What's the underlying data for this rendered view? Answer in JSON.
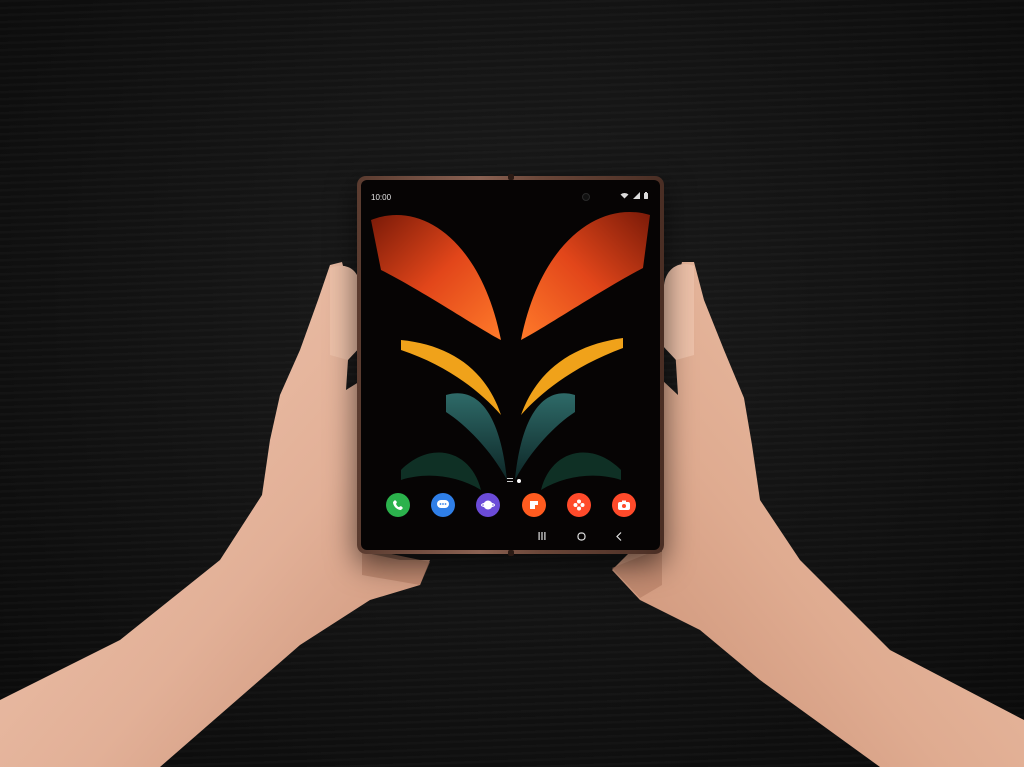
{
  "status_bar": {
    "time": "10:00",
    "icons": [
      "wifi-icon",
      "signal-icon",
      "battery-icon"
    ]
  },
  "home_screen": {
    "page_indicator": [
      "apps-grid-indicator",
      "current-page-dot"
    ],
    "dock": [
      {
        "name": "phone-app-icon",
        "color": "#2bb24c"
      },
      {
        "name": "messages-app-icon",
        "color": "#2f7fe8"
      },
      {
        "name": "internet-app-icon",
        "color": "#6b4bd8"
      },
      {
        "name": "store-app-icon",
        "color": "#ff5b1f"
      },
      {
        "name": "gallery-app-icon",
        "color": "#ff4a2a"
      },
      {
        "name": "camera-app-icon",
        "color": "#ff4a2a"
      }
    ]
  },
  "nav_bar": {
    "buttons": [
      "recents-icon",
      "home-icon",
      "back-icon"
    ]
  },
  "colors": {
    "background": "#111111",
    "wallpaper_orange": "#e2461a",
    "wallpaper_yellow": "#f0a21a",
    "wallpaper_teal": "#1d4d4d",
    "phone_frame": "#7a5446",
    "skin": "#e9bda4"
  }
}
